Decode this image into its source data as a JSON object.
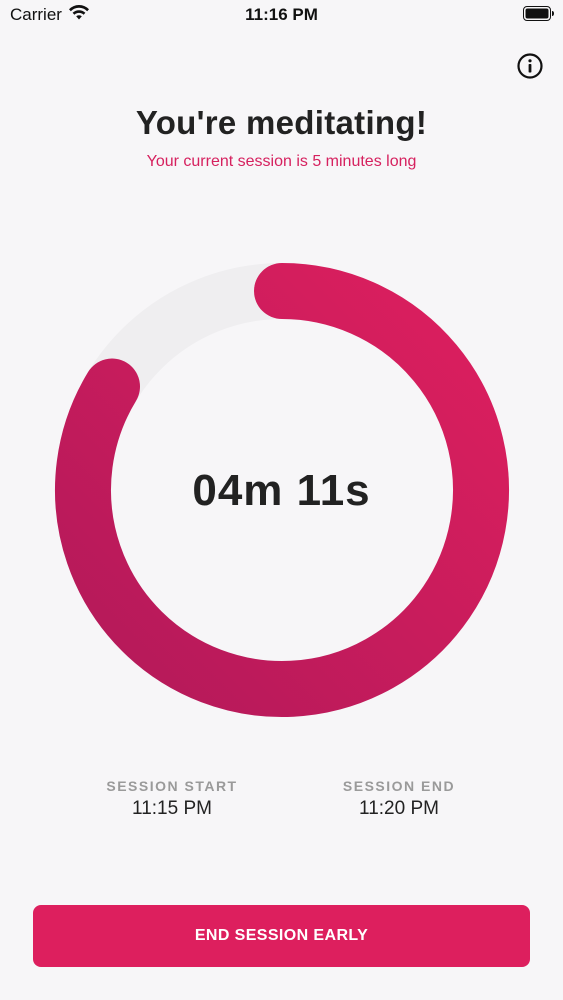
{
  "status_bar": {
    "carrier": "Carrier",
    "time": "11:16 PM"
  },
  "header": {
    "title": "You're meditating!",
    "subtitle": "Your current session is 5 minutes long"
  },
  "timer": {
    "remaining": "04m 11s",
    "progress_fraction": 0.837
  },
  "session": {
    "start_label": "SESSION START",
    "start_time": "11:15 PM",
    "end_label": "SESSION END",
    "end_time": "11:20 PM"
  },
  "actions": {
    "end_button_label": "END SESSION EARLY"
  },
  "colors": {
    "accent": "#dd1f5e",
    "accent_dark": "#b5195a",
    "track": "#efeef0",
    "background": "#f7f6f8"
  },
  "icons": {
    "info": "info-circle-icon",
    "wifi": "wifi-icon",
    "battery": "battery-icon"
  }
}
